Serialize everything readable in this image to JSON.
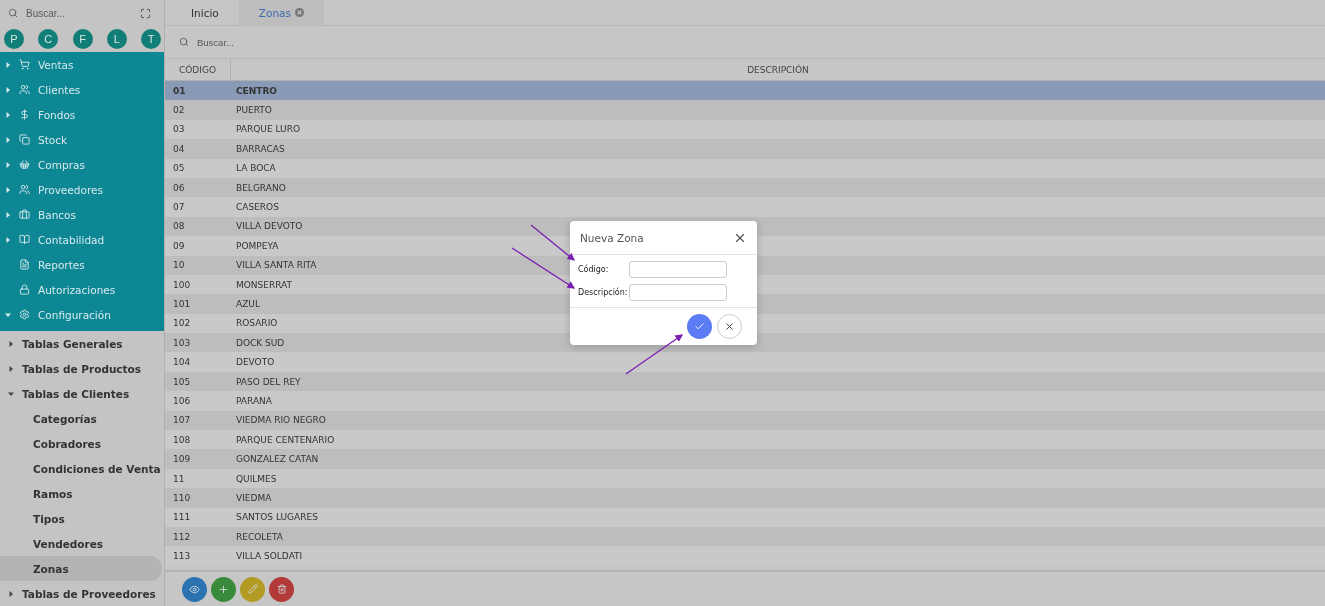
{
  "sidebar": {
    "search": {
      "placeholder": "Buscar..."
    },
    "letter_buttons": [
      "P",
      "C",
      "F",
      "L",
      "T"
    ],
    "menu": [
      {
        "label": "Ventas",
        "kind": "group",
        "expanded": false
      },
      {
        "label": "Clientes",
        "kind": "group",
        "expanded": false
      },
      {
        "label": "Fondos",
        "kind": "group",
        "expanded": false
      },
      {
        "label": "Stock",
        "kind": "group",
        "expanded": false
      },
      {
        "label": "Compras",
        "kind": "group",
        "expanded": false
      },
      {
        "label": "Proveedores",
        "kind": "group",
        "expanded": false
      },
      {
        "label": "Bancos",
        "kind": "group",
        "expanded": false
      },
      {
        "label": "Contabilidad",
        "kind": "group",
        "expanded": false
      },
      {
        "label": "Reportes",
        "kind": "leaf"
      },
      {
        "label": "Autorizaciones",
        "kind": "leaf"
      },
      {
        "label": "Configuración",
        "kind": "group",
        "expanded": true,
        "children": [
          {
            "label": "Tablas Generales",
            "kind": "group",
            "expanded": false
          },
          {
            "label": "Tablas de Productos",
            "kind": "group",
            "expanded": false
          },
          {
            "label": "Tablas de Clientes",
            "kind": "group",
            "expanded": true,
            "children": [
              {
                "label": "Categorías",
                "kind": "leaf",
                "selected": false
              },
              {
                "label": "Cobradores",
                "kind": "leaf",
                "selected": false
              },
              {
                "label": "Condiciones de Venta",
                "kind": "leaf",
                "selected": false
              },
              {
                "label": "Ramos",
                "kind": "leaf",
                "selected": false
              },
              {
                "label": "Tipos",
                "kind": "leaf",
                "selected": false
              },
              {
                "label": "Vendedores",
                "kind": "leaf",
                "selected": false
              },
              {
                "label": "Zonas",
                "kind": "leaf",
                "selected": true
              }
            ]
          },
          {
            "label": "Tablas de Proveedores",
            "kind": "group",
            "expanded": false
          }
        ]
      }
    ]
  },
  "tabs": [
    {
      "label": "Inicio",
      "selected": false,
      "closable": false
    },
    {
      "label": "Zonas",
      "selected": true,
      "closable": true
    }
  ],
  "search": {
    "placeholder": "Buscar..."
  },
  "table": {
    "columns": [
      "CÓDIGO",
      "DESCRIPCIÓN"
    ],
    "rows": [
      {
        "code": "01",
        "description": "CENTRO",
        "selected": true
      },
      {
        "code": "02",
        "description": "PUERTO",
        "selected": false
      },
      {
        "code": "03",
        "description": "PARQUE LURO",
        "selected": false
      },
      {
        "code": "04",
        "description": "BARRACAS",
        "selected": false
      },
      {
        "code": "05",
        "description": "LA BOCA",
        "selected": false
      },
      {
        "code": "06",
        "description": "BELGRANO",
        "selected": false
      },
      {
        "code": "07",
        "description": "CASEROS",
        "selected": false
      },
      {
        "code": "08",
        "description": "VILLA DEVOTO",
        "selected": false
      },
      {
        "code": "09",
        "description": "POMPEYA",
        "selected": false
      },
      {
        "code": "10",
        "description": "VILLA SANTA RITA",
        "selected": false
      },
      {
        "code": "100",
        "description": "MONSERRAT",
        "selected": false
      },
      {
        "code": "101",
        "description": "AZUL",
        "selected": false
      },
      {
        "code": "102",
        "description": "ROSARIO",
        "selected": false
      },
      {
        "code": "103",
        "description": "DOCK SUD",
        "selected": false
      },
      {
        "code": "104",
        "description": "DEVOTO",
        "selected": false
      },
      {
        "code": "105",
        "description": "PASO DEL REY",
        "selected": false
      },
      {
        "code": "106",
        "description": "PARANA",
        "selected": false
      },
      {
        "code": "107",
        "description": "VIEDMA RIO NEGRO",
        "selected": false
      },
      {
        "code": "108",
        "description": "PARQUE CENTENARIO",
        "selected": false
      },
      {
        "code": "109",
        "description": "GONZALEZ CATAN",
        "selected": false
      },
      {
        "code": "11",
        "description": "QUILMES",
        "selected": false
      },
      {
        "code": "110",
        "description": "VIEDMA",
        "selected": false
      },
      {
        "code": "111",
        "description": "SANTOS LUGARES",
        "selected": false
      },
      {
        "code": "112",
        "description": "RECOLETA",
        "selected": false
      },
      {
        "code": "113",
        "description": "VILLA SOLDATI",
        "selected": false
      }
    ]
  },
  "dialog": {
    "title": "Nueva Zona",
    "fields": [
      {
        "label": "Código:"
      },
      {
        "label": "Descripción:"
      }
    ]
  }
}
